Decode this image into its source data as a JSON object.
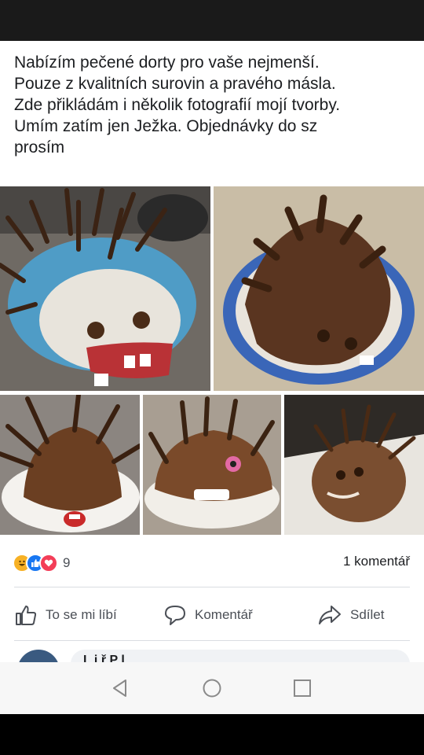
{
  "post": {
    "text": "Nabízím pečené dorty pro vaše nejmenší.\nPouze z kvalitních surovin a pravého másla.\nZde přikládám i několik fotografií mojí tvorby.\nUmím zatím jen Ježka. Objednávky do sz\nprosím"
  },
  "reactions": {
    "icons": [
      "haha-icon",
      "like-icon",
      "love-icon"
    ],
    "count": "9",
    "colors": {
      "haha": "#f7b125",
      "like": "#1877f2",
      "love": "#f33e58"
    }
  },
  "comments_count": "1 komentář",
  "actions": {
    "like": "To se mi líbí",
    "comment": "Komentář",
    "share": "Sdílet"
  },
  "comment_preview": {
    "name": "L  i  ř P  l  "
  },
  "nav": {
    "icons": [
      "back-icon",
      "home-icon",
      "recents-icon"
    ]
  }
}
